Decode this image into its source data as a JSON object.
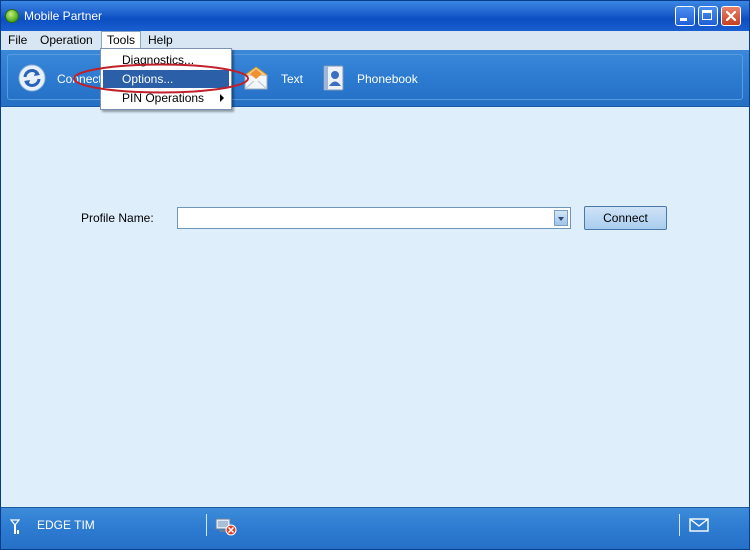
{
  "window": {
    "title": "Mobile Partner"
  },
  "menu": {
    "items": [
      "File",
      "Operation",
      "Tools",
      "Help"
    ]
  },
  "tools_menu": {
    "items": [
      {
        "label": "Diagnostics..."
      },
      {
        "label": "Options..."
      },
      {
        "label": "PIN Operations"
      }
    ]
  },
  "toolbar": {
    "connect_label": "Connect",
    "text_label": "Text",
    "phonebook_label": "Phonebook"
  },
  "main": {
    "profile_label": "Profile Name:",
    "profile_value": "",
    "connect_button": "Connect"
  },
  "status": {
    "network": "EDGE  TIM"
  },
  "icons": {
    "app": "app-icon",
    "connect": "connect-refresh-icon",
    "text": "envelope-icon",
    "phonebook": "phonebook-icon",
    "signal": "signal-antenna-icon",
    "connection_status": "disconnected-icon",
    "messages": "message-icon"
  },
  "colors": {
    "titlebar": "#0b4ec2",
    "toolbar": "#2d7bd1",
    "content_bg": "#dfeefb",
    "menu_highlight": "#2b5fa7",
    "annotation": "#c0202a"
  }
}
